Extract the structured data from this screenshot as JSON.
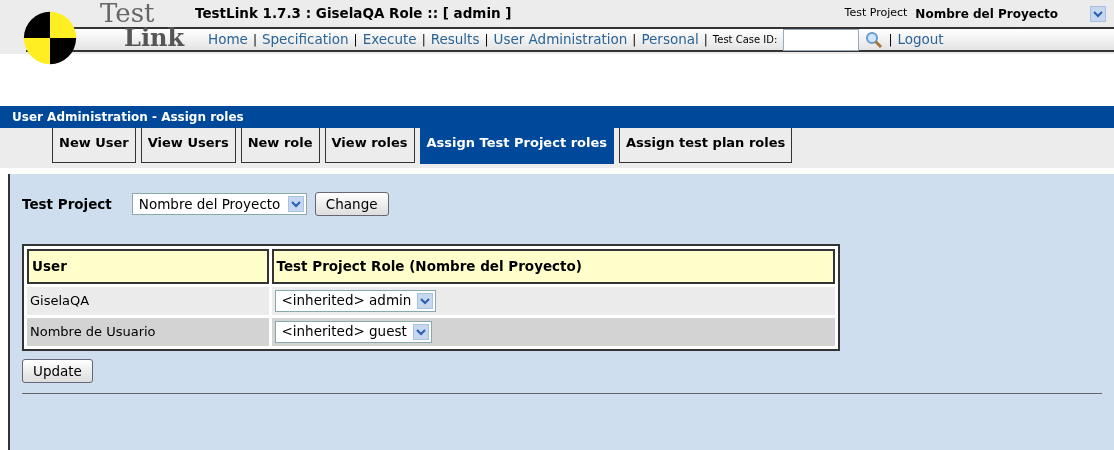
{
  "logo": {
    "top": "Test",
    "bottom": "Link"
  },
  "header": {
    "title": "TestLink 1.7.3 : GiselaQA Role :: [ admin ]",
    "project_label": "Test Project",
    "project_name": "Nombre del Proyecto"
  },
  "nav": {
    "links": [
      "Home",
      "Specification",
      "Execute",
      "Results",
      "User Administration",
      "Personal"
    ],
    "separator": "|",
    "test_case_label": "Test Case ID:",
    "logout": "Logout"
  },
  "page_title": "User Administration - Assign roles",
  "tabs": [
    {
      "label": "New User",
      "selected": false
    },
    {
      "label": "View Users",
      "selected": false
    },
    {
      "label": "New role",
      "selected": false
    },
    {
      "label": "View roles",
      "selected": false
    },
    {
      "label": "Assign Test Project roles",
      "selected": true
    },
    {
      "label": "Assign test plan roles",
      "selected": false
    }
  ],
  "project_form": {
    "label": "Test Project",
    "value": "Nombre del Proyecto",
    "button": "Change"
  },
  "table": {
    "columns": [
      "User",
      "Test Project Role (Nombre del Proyecto)"
    ],
    "rows": [
      {
        "user": "GiselaQA",
        "role": "<inherited> admin"
      },
      {
        "user": "Nombre de Usuario",
        "role": "<inherited> guest"
      }
    ]
  },
  "update_button": "Update"
}
